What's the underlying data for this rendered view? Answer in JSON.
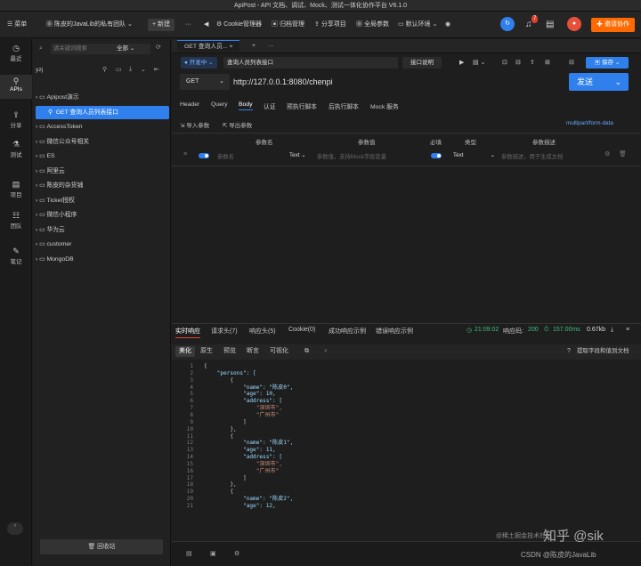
{
  "window": {
    "title": "ApiPost - API 文档、调试、Mock、测试一体化协作平台 V6.1.0"
  },
  "topbar": {
    "menu": "菜单",
    "team": "陈皮的JavaLib的私有团队",
    "new": "+ 新建",
    "more": "···",
    "back": "◀",
    "cookie": "Cookie管理器",
    "archive": "归档管理",
    "share": "分享项目",
    "global_params": "全局参数",
    "env": "默认环境",
    "notify_badge": "7",
    "invite": "邀请协作"
  },
  "rail": [
    {
      "label": "最近",
      "icon": "clock-icon",
      "glyph": "◷"
    },
    {
      "label": "APIs",
      "icon": "link-icon",
      "glyph": "⚲"
    },
    {
      "label": "分享",
      "icon": "share-icon",
      "glyph": "⇪"
    },
    {
      "label": "测试",
      "icon": "test-icon",
      "glyph": "⚗"
    },
    {
      "label": "项目",
      "icon": "project-icon",
      "glyph": "▤"
    },
    {
      "label": "团队",
      "icon": "team-icon",
      "glyph": "☷"
    },
    {
      "label": "笔记",
      "icon": "note-icon",
      "glyph": "✎"
    }
  ],
  "sidebar": {
    "search_placeholder": "请关键词搜索",
    "filter": "全部",
    "user": "yzj",
    "recycle": "回收站",
    "items": [
      "Apipost演示",
      "GET   查询人员列表接口",
      "AccessToken",
      "微信公众号相关",
      "ES",
      "阿里云",
      "陈皮的杂货铺",
      "Ticket授权",
      "微信小程序",
      "华为云",
      "customer",
      "MongoDB"
    ]
  },
  "tabs": {
    "active": "GET 查询人员...",
    "plus": "+",
    "more": "···"
  },
  "request": {
    "status": "● 开发中",
    "name": "查询人员列表接口",
    "doc": "接口说明",
    "save": "保存",
    "method": "GET",
    "url": "http://127.0.0.1:8080/chenpi",
    "send": "发送"
  },
  "subtabs": [
    "Header",
    "Query",
    "Body",
    "认证",
    "预执行脚本",
    "后执行脚本",
    "Mock 服务"
  ],
  "body": {
    "import": "导入参数",
    "export": "导出参数",
    "content_type": "multipart/form-data",
    "headers": [
      "参数名",
      "参数值",
      "必填",
      "类型",
      "参数描述"
    ],
    "row": {
      "name_ph": "参数名",
      "type": "Text",
      "value_ph": "参数值，支持Mock字段变量",
      "req_type": "Text",
      "desc_ph": "参数描述，用于生成文档"
    }
  },
  "response": {
    "tabs": [
      "实时响应",
      "请求头(7)",
      "响应头(5)",
      "Cookie(0)",
      "成功响应示例",
      "错误响应示例"
    ],
    "time": "21:09:02",
    "status_label": "响应码:",
    "status": "200",
    "duration": "157.00ms",
    "size": "0.67kb",
    "views": [
      "美化",
      "原生",
      "预览",
      "断言",
      "可视化"
    ],
    "extract": "提取字段和值到文档"
  },
  "code": [
    "{",
    "    \"persons\": [",
    "        {",
    "            \"name\": \"陈皮0\",",
    "            \"age\": 10,",
    "            \"address\": [",
    "                \"深圳市\",",
    "                \"广州市\"",
    "            ]",
    "        },",
    "        {",
    "            \"name\": \"陈皮1\",",
    "            \"age\": 11,",
    "            \"address\": [",
    "                \"深圳市\",",
    "                \"广州市\"",
    "            ]",
    "        },",
    "        {",
    "            \"name\": \"陈皮2\",",
    "            \"age\": 12,"
  ],
  "watermark": {
    "zhihu": "知乎 @sik",
    "csdn": "CSDN @陈皮的JavaLib",
    "juejin": "@稀土掘金技术社区"
  }
}
